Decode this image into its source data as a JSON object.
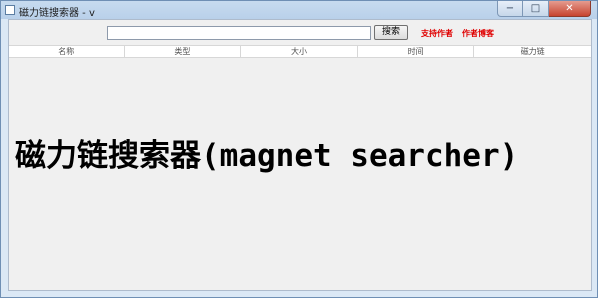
{
  "window": {
    "title": "磁力链搜索器 - v",
    "controls": {
      "minimize": "−",
      "maximize": "□",
      "close": "✕"
    }
  },
  "toolbar": {
    "search_value": "",
    "search_button": "搜索",
    "support_author": "支持作者",
    "author_blog": "作者博客"
  },
  "table": {
    "columns": [
      "名称",
      "类型",
      "大小",
      "时间",
      "磁力链"
    ],
    "rows": []
  },
  "overlay": {
    "caption": "磁力链搜索器(magnet searcher)"
  },
  "colors": {
    "link_red": "#e00000",
    "title_bar": "#c7dbef",
    "close_button": "#c7432f"
  },
  "icons": {
    "app": "app-icon",
    "minimize": "minimize-icon",
    "maximize": "maximize-icon",
    "close": "close-icon"
  }
}
